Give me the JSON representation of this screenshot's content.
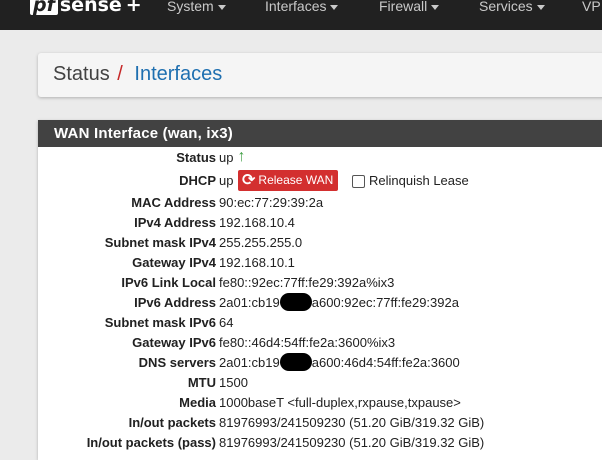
{
  "navbar": {
    "brand_pf": "pf",
    "brand_sense": "sense",
    "brand_plus": "+",
    "items": [
      {
        "label": "System"
      },
      {
        "label": "Interfaces"
      },
      {
        "label": "Firewall"
      },
      {
        "label": "Services"
      },
      {
        "label": "VP"
      }
    ]
  },
  "breadcrumb": {
    "root": "Status",
    "separator": "/",
    "current": "Interfaces"
  },
  "panel": {
    "title": "WAN Interface (wan, ix3)",
    "status": {
      "label": "Status",
      "value": "up",
      "icon": "arrow-up-icon"
    },
    "dhcp": {
      "label": "DHCP",
      "value": "up",
      "release_button": "Release WAN",
      "release_icon": "refresh-icon",
      "relinquish_label": "Relinquish Lease",
      "relinquish_checked": false
    },
    "rows": [
      {
        "label": "MAC Address",
        "value": "90:ec:77:29:39:2a"
      },
      {
        "label": "IPv4 Address",
        "value": "192.168.10.4"
      },
      {
        "label": "Subnet mask IPv4",
        "value": "255.255.255.0"
      },
      {
        "label": "Gateway IPv4",
        "value": "192.168.10.1"
      },
      {
        "label": "IPv6 Link Local",
        "value": "fe80::92ec:77ff:fe29:392a%ix3"
      }
    ],
    "ipv6_address": {
      "label": "IPv6 Address",
      "value_prefix": "2a01:cb19",
      "value_suffix": "a600:92ec:77ff:fe29:392a"
    },
    "rows2": [
      {
        "label": "Subnet mask IPv6",
        "value": "64"
      },
      {
        "label": "Gateway IPv6",
        "value": "fe80::46d4:54ff:fe2a:3600%ix3"
      }
    ],
    "dns": {
      "label": "DNS servers",
      "value_prefix": "2a01:cb19",
      "value_suffix": "a600:46d4:54ff:fe2a:3600"
    },
    "rows3": [
      {
        "label": "MTU",
        "value": "1500"
      },
      {
        "label": "Media",
        "value": "1000baseT <full-duplex,rxpause,txpause>"
      },
      {
        "label": "In/out packets",
        "value": "81976993/241509230 (51.20 GiB/319.32 GiB)"
      },
      {
        "label": "In/out packets (pass)",
        "value": "81976993/241509230 (51.20 GiB/319.32 GiB)"
      }
    ]
  },
  "colors": {
    "navbar_bg": "#212121",
    "panel_heading_bg": "#424242",
    "release_button_bg": "#d32f2f",
    "status_up": "#43a047",
    "breadcrumb_link": "#1e6fb0",
    "breadcrumb_separator": "#c62828"
  }
}
